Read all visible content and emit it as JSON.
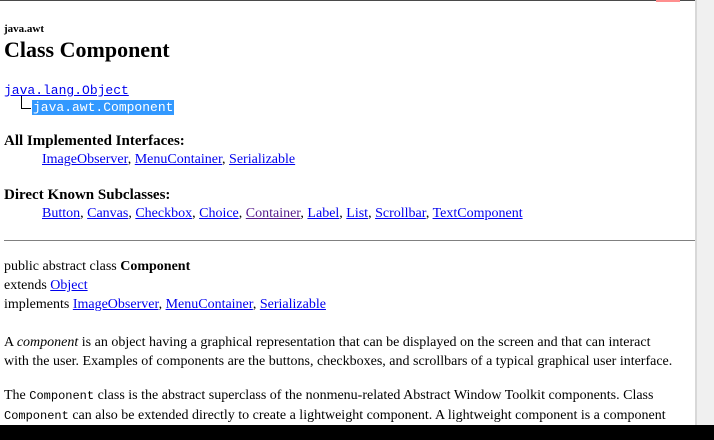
{
  "header": {
    "package": "java.awt",
    "title": "Class Component"
  },
  "inheritance": {
    "parent": "java.lang.Object",
    "current": "java.awt.Component"
  },
  "interfaces": {
    "heading": "All Implemented Interfaces:",
    "items": [
      "ImageObserver",
      "MenuContainer",
      "Serializable"
    ]
  },
  "subclasses": {
    "heading": "Direct Known Subclasses:",
    "items": [
      "Button",
      "Canvas",
      "Checkbox",
      "Choice",
      "Container",
      "Label",
      "List",
      "Scrollbar",
      "TextComponent"
    ]
  },
  "declaration": {
    "prefix": "public abstract class ",
    "name": "Component",
    "extends_label": "extends ",
    "extends_link": "Object",
    "implements_label": "implements ",
    "implements": [
      "ImageObserver",
      "MenuContainer",
      "Serializable"
    ]
  },
  "description": {
    "p1_a": "A ",
    "p1_italic": "component",
    "p1_b": " is an object having a graphical representation that can be displayed on the screen and that can interact",
    "p1_line2": "with the user. Examples of components are the buttons, checkboxes, and scrollbars of a typical graphical user interface.",
    "p2_a": "The ",
    "p2_code1": "Component",
    "p2_b": " class is the abstract superclass of the nonmenu-related Abstract Window Toolkit components. Class",
    "p2_code2": "Component",
    "p2_c": " can also be extended directly to create a lightweight component. A lightweight component is a component"
  },
  "colors": {
    "link": "#0000ee",
    "visited_link": "#551a8b",
    "selection": "#3399ff"
  }
}
